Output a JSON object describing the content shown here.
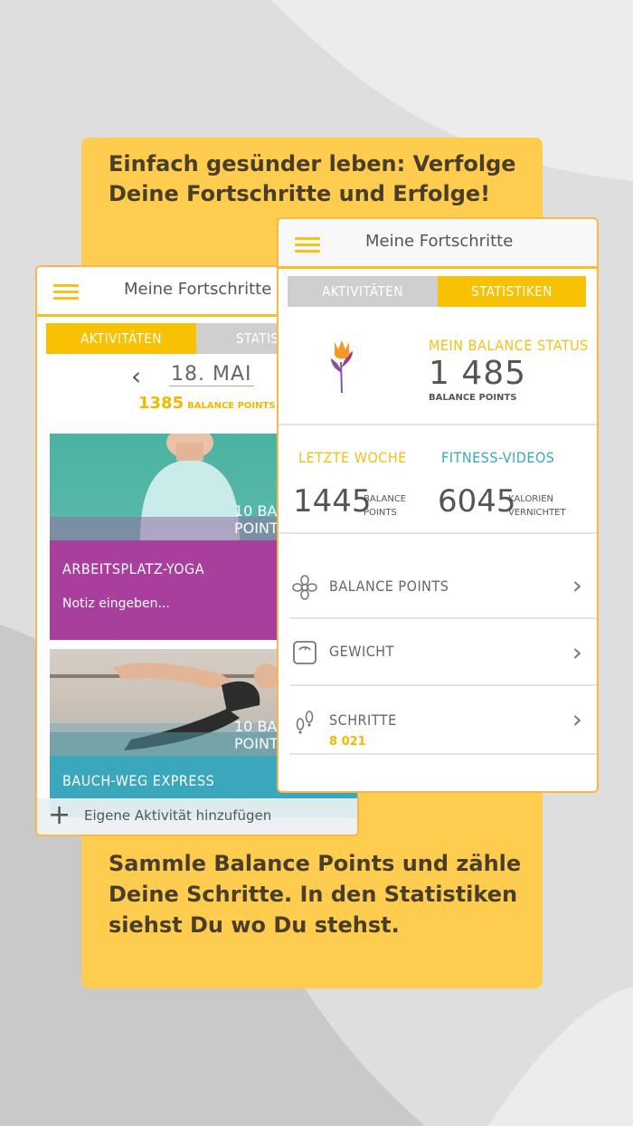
{
  "headline": {
    "line1": "Einfach gesünder leben: Verfolge",
    "line2": "Deine Fortschritte und Erfolge!"
  },
  "footer_text": {
    "line1": "Sammle Balance Points und zähle",
    "line2": "Deine Schritte. In den Statistiken",
    "line3": "siehst Du wo Du stehst."
  },
  "back_screen": {
    "title": "Meine Fortschritte",
    "tabs": [
      "AKTIVITÄTEN",
      "STATISTIKEN"
    ],
    "date": "18. MAI",
    "balance_points_value": "1385",
    "balance_points_label": "BALANCE POINTS",
    "activities": [
      {
        "title": "ARBEITSPLATZ-YOGA",
        "band": "10 BALANCE POINTS",
        "note": "Notiz eingeben...",
        "color": "#a83f9d"
      },
      {
        "title": "BAUCH-WEG EXPRESS",
        "band": "10 BALANCE POINTS",
        "note": "",
        "color": "#3aa7bd"
      }
    ],
    "add_label": "Eigene Aktivität hinzufügen",
    "add_icon": "plus-icon"
  },
  "front_screen": {
    "title": "Meine Fortschritte",
    "tabs": [
      "AKTIVITÄTEN",
      "STATISTIKEN"
    ],
    "status": {
      "label": "MEIN BALANCE STATUS",
      "value": "1 485",
      "unit": "BALANCE POINTS",
      "icon": "tulip-icon"
    },
    "last_week": {
      "label": "LETZTE WOCHE",
      "value": "1445",
      "unit_line1": "BALANCE",
      "unit_line2": "POINTS"
    },
    "fitness_videos": {
      "label": "FITNESS-VIDEOS",
      "value": "6045",
      "unit_line1": "KALORIEN",
      "unit_line2": "VERNICHTET"
    },
    "list": [
      {
        "label": "BALANCE POINTS",
        "sub": "",
        "icon": "flower-icon"
      },
      {
        "label": "GEWICHT",
        "sub": "",
        "icon": "scale-icon"
      },
      {
        "label": "SCHRITTE",
        "sub": "8 021",
        "icon": "footsteps-icon"
      }
    ]
  },
  "colors": {
    "accent_yellow": "#f8c102",
    "card_yellow": "#fecd4f",
    "headline_text": "#4a3e2a",
    "stat_yellow": "#f4c117",
    "stat_teal": "#3aa7bd",
    "yoga_purple": "#a83f9d"
  }
}
